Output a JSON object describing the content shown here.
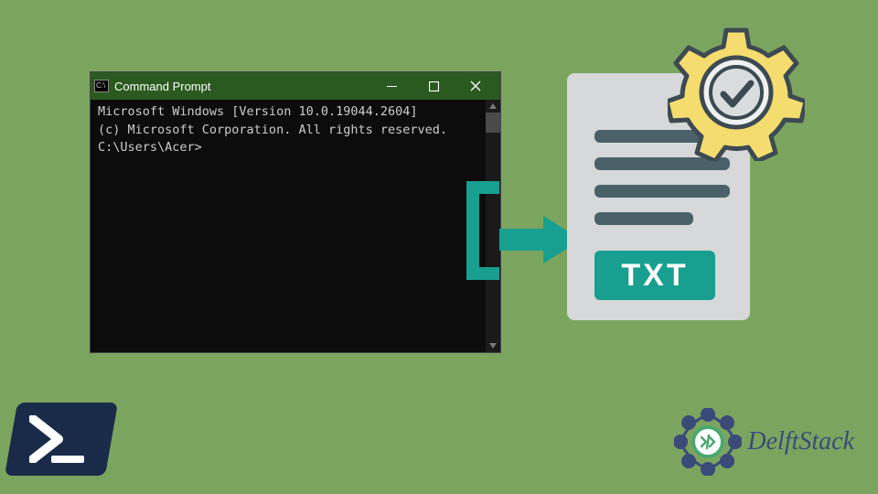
{
  "window": {
    "title": "Command Prompt",
    "icon_label": "C:\\"
  },
  "terminal": {
    "line1": "Microsoft Windows [Version 10.0.19044.2604]",
    "line2": "(c) Microsoft Corporation. All rights reserved.",
    "blank": "",
    "prompt": "C:\\Users\\Acer>"
  },
  "txt_label": "TXT",
  "logo_text": "DelftStack",
  "colors": {
    "bg": "#7ba55f",
    "teal": "#189f90",
    "doc": "#d6d8d9",
    "docline": "#4a6169",
    "gear": "#f4dd6e",
    "gearstroke": "#3d4a52",
    "check": "#3d4a52",
    "ps": "#1a2b4a",
    "ds_blue": "#3a4a79",
    "ds_green": "#4aa870"
  }
}
